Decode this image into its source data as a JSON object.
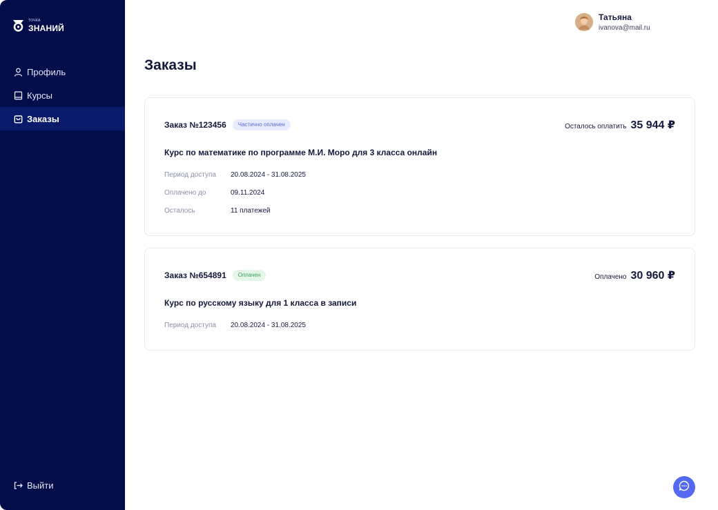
{
  "brand": {
    "small": "ТОЧКА",
    "big": "ЗНАНИЙ"
  },
  "sidebar": {
    "items": [
      {
        "label": "Профиль",
        "icon": "user-icon"
      },
      {
        "label": "Курсы",
        "icon": "book-icon"
      },
      {
        "label": "Заказы",
        "icon": "shopping-bag-icon"
      }
    ],
    "active_index": 2,
    "logout_label": "Выйти"
  },
  "user": {
    "name": "Татьяна",
    "email": "ivanova@mail.ru"
  },
  "page": {
    "title": "Заказы"
  },
  "orders": [
    {
      "number": "Заказ №123456",
      "status": "Частично оплачен",
      "amount_label": "Осталось оплатить",
      "amount": "35 944 ₽",
      "course": "Курс по математике по программе М.И. Моро для 3 класса онлайн",
      "details": [
        {
          "key": "Период доступа",
          "value": "20.08.2024 - 31.08.2025"
        },
        {
          "key": "Оплачено до",
          "value": "09.11.2024"
        },
        {
          "key": "Осталось",
          "value": "11 платежей"
        }
      ]
    },
    {
      "number": "Заказ №654891",
      "status": "Оплачен",
      "amount_label": "Оплачено",
      "amount": "30 960 ₽",
      "course": "Курс по русскому языку для 1 класса в записи",
      "details": [
        {
          "key": "Период доступа",
          "value": "20.08.2024 - 31.08.2025"
        }
      ]
    }
  ],
  "colors": {
    "sidebar_bg": "#030d4a",
    "sidebar_active": "#0a1a6b",
    "accent": "#5468f2",
    "badge_partial": "#5a6ad8",
    "badge_paid": "#3aa05a"
  }
}
